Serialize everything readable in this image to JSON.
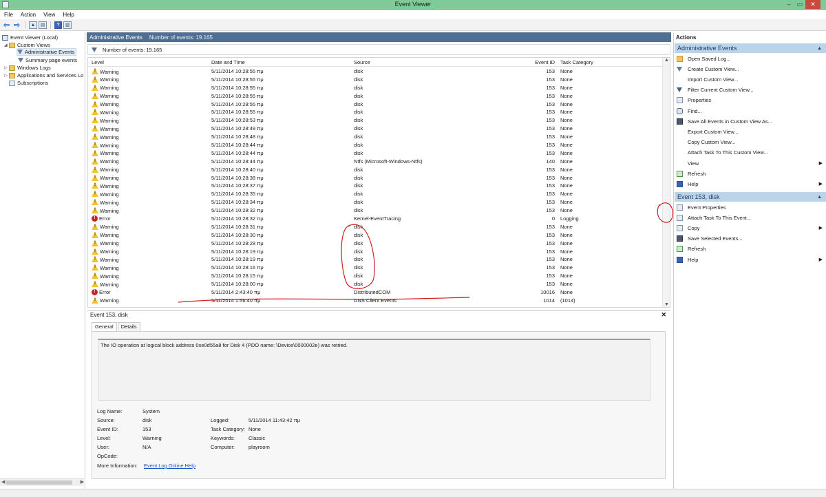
{
  "window": {
    "title": "Event Viewer",
    "min": "–",
    "max": "▭",
    "close": "✕"
  },
  "menu": [
    "File",
    "Action",
    "View",
    "Help"
  ],
  "tree": {
    "root": "Event Viewer (Local)",
    "custom_views": "Custom Views",
    "admin_events": "Administrative Events",
    "summary": "Summary page events",
    "windows_logs": "Windows Logs",
    "app_services": "Applications and Services Lo",
    "subscriptions": "Subscriptions"
  },
  "center": {
    "title": "Administrative Events",
    "count": "Number of events: 19.165",
    "filter_text": "Number of events: 19.165",
    "columns": {
      "level": "Level",
      "date": "Date and Time",
      "source": "Source",
      "event_id": "Event ID",
      "task": "Task Category"
    },
    "rows": [
      {
        "level": "Warning",
        "date": "5/11/2014 10:28:55 πμ",
        "source": "disk",
        "id": "153",
        "task": "None"
      },
      {
        "level": "Warning",
        "date": "5/11/2014 10:28:55 πμ",
        "source": "disk",
        "id": "153",
        "task": "None"
      },
      {
        "level": "Warning",
        "date": "5/11/2014 10:28:55 πμ",
        "source": "disk",
        "id": "153",
        "task": "None"
      },
      {
        "level": "Warning",
        "date": "5/11/2014 10:28:55 πμ",
        "source": "disk",
        "id": "153",
        "task": "None"
      },
      {
        "level": "Warning",
        "date": "5/11/2014 10:28:55 πμ",
        "source": "disk",
        "id": "153",
        "task": "None"
      },
      {
        "level": "Warning",
        "date": "5/11/2014 10:28:55 πμ",
        "source": "disk",
        "id": "153",
        "task": "None"
      },
      {
        "level": "Warning",
        "date": "5/11/2014 10:28:53 πμ",
        "source": "disk",
        "id": "153",
        "task": "None"
      },
      {
        "level": "Warning",
        "date": "5/11/2014 10:28:49 πμ",
        "source": "disk",
        "id": "153",
        "task": "None"
      },
      {
        "level": "Warning",
        "date": "5/11/2014 10:28:48 πμ",
        "source": "disk",
        "id": "153",
        "task": "None"
      },
      {
        "level": "Warning",
        "date": "5/11/2014 10:28:44 πμ",
        "source": "disk",
        "id": "153",
        "task": "None"
      },
      {
        "level": "Warning",
        "date": "5/11/2014 10:28:44 πμ",
        "source": "disk",
        "id": "153",
        "task": "None"
      },
      {
        "level": "Warning",
        "date": "5/11/2014 10:28:44 πμ",
        "source": "Ntfs (Microsoft-Windows-Ntfs)",
        "id": "140",
        "task": "None"
      },
      {
        "level": "Warning",
        "date": "5/11/2014 10:28:40 πμ",
        "source": "disk",
        "id": "153",
        "task": "None"
      },
      {
        "level": "Warning",
        "date": "5/11/2014 10:28:38 πμ",
        "source": "disk",
        "id": "153",
        "task": "None"
      },
      {
        "level": "Warning",
        "date": "5/11/2014 10:28:37 πμ",
        "source": "disk",
        "id": "153",
        "task": "None"
      },
      {
        "level": "Warning",
        "date": "5/11/2014 10:28:35 πμ",
        "source": "disk",
        "id": "153",
        "task": "None"
      },
      {
        "level": "Warning",
        "date": "5/11/2014 10:28:34 πμ",
        "source": "disk",
        "id": "153",
        "task": "None"
      },
      {
        "level": "Warning",
        "date": "5/11/2014 10:28:32 πμ",
        "source": "disk",
        "id": "153",
        "task": "None"
      },
      {
        "level": "Error",
        "date": "5/11/2014 10:28:32 πμ",
        "source": "Kernel-EventTracing",
        "id": "0",
        "task": "Logging"
      },
      {
        "level": "Warning",
        "date": "5/11/2014 10:28:31 πμ",
        "source": "disk",
        "id": "153",
        "task": "None"
      },
      {
        "level": "Warning",
        "date": "5/11/2014 10:28:30 πμ",
        "source": "disk",
        "id": "153",
        "task": "None"
      },
      {
        "level": "Warning",
        "date": "5/11/2014 10:28:28 πμ",
        "source": "disk",
        "id": "153",
        "task": "None"
      },
      {
        "level": "Warning",
        "date": "5/11/2014 10:28:19 πμ",
        "source": "disk",
        "id": "153",
        "task": "None"
      },
      {
        "level": "Warning",
        "date": "5/11/2014 10:28:19 πμ",
        "source": "disk",
        "id": "153",
        "task": "None"
      },
      {
        "level": "Warning",
        "date": "5/11/2014 10:28:16 πμ",
        "source": "disk",
        "id": "153",
        "task": "None"
      },
      {
        "level": "Warning",
        "date": "5/11/2014 10:28:15 πμ",
        "source": "disk",
        "id": "153",
        "task": "None"
      },
      {
        "level": "Warning",
        "date": "5/11/2014 10:28:00 πμ",
        "source": "disk",
        "id": "153",
        "task": "None"
      },
      {
        "level": "Error",
        "date": "5/11/2014 2:43:40 πμ",
        "source": "DistributedCOM",
        "id": "10016",
        "task": "None"
      },
      {
        "level": "Warning",
        "date": "5/11/2014 1:56:40 πμ",
        "source": "DNS Client Events",
        "id": "1014",
        "task": "(1014)"
      }
    ]
  },
  "detail": {
    "title": "Event 153, disk",
    "close": "✕",
    "tab_general": "General",
    "tab_details": "Details",
    "description": "The IO operation at logical block address 0xe0d55a8 for Disk 4 (PDO name: \\Device\\0000002e) was retried.",
    "labels": {
      "log_name": "Log Name:",
      "source": "Source:",
      "event_id": "Event ID:",
      "level": "Level:",
      "user": "User:",
      "opcode": "OpCode:",
      "more_info": "More Information:",
      "logged": "Logged:",
      "task": "Task Category:",
      "keywords": "Keywords:",
      "computer": "Computer:"
    },
    "values": {
      "log_name": "System",
      "source": "disk",
      "event_id": "153",
      "level": "Warning",
      "user": "N/A",
      "more_info": "Event Log Online Help",
      "logged": "5/11/2014 11:43:42 πμ",
      "task": "None",
      "keywords": "Classic",
      "computer": "playroom"
    }
  },
  "actions": {
    "title": "Actions",
    "section1": "Administrative Events",
    "section1_items": [
      {
        "label": "Open Saved Log...",
        "icon": "folder"
      },
      {
        "label": "Create Custom View...",
        "icon": "filter"
      },
      {
        "label": "Import Custom View...",
        "icon": "none"
      },
      {
        "label": "Filter Current Custom View...",
        "icon": "filter2"
      },
      {
        "label": "Properties",
        "icon": "props"
      },
      {
        "label": "Find...",
        "icon": "find"
      },
      {
        "label": "Save All Events in Custom View As...",
        "icon": "save"
      },
      {
        "label": "Export Custom View...",
        "icon": "none"
      },
      {
        "label": "Copy Custom View...",
        "icon": "none"
      },
      {
        "label": "Attach Task To This Custom View...",
        "icon": "none"
      },
      {
        "label": "View",
        "icon": "none"
      },
      {
        "label": "Refresh",
        "icon": "refresh"
      },
      {
        "label": "Help",
        "icon": "help"
      }
    ],
    "section2": "Event 153, disk",
    "section2_items": [
      {
        "label": "Event Properties",
        "icon": "props"
      },
      {
        "label": "Attach Task To This Event...",
        "icon": "props"
      },
      {
        "label": "Copy",
        "icon": "props"
      },
      {
        "label": "Save Selected Events...",
        "icon": "save"
      },
      {
        "label": "Refresh",
        "icon": "refresh"
      },
      {
        "label": "Help",
        "icon": "help"
      }
    ]
  },
  "colors": {
    "title_bar": "#7fcb97",
    "header": "#4f6f93",
    "section": "#bcd4ea",
    "annotation": "#d01f27"
  }
}
